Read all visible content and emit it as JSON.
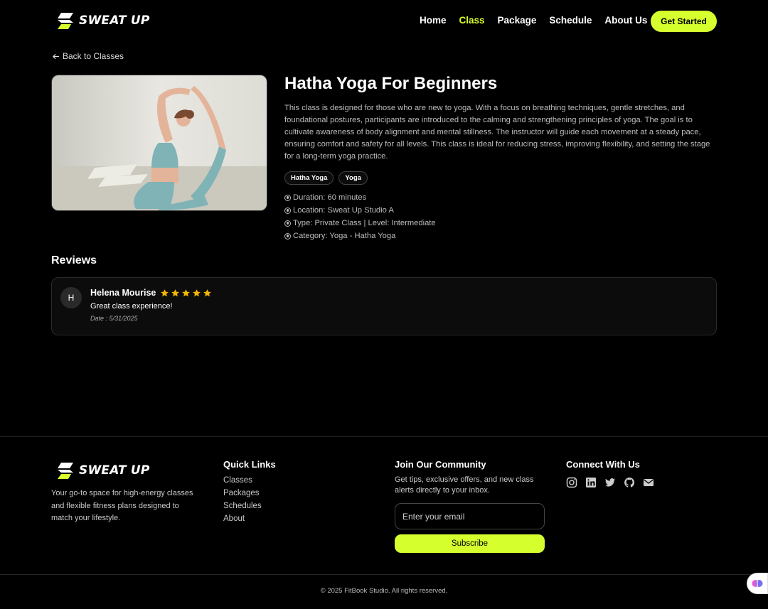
{
  "brand": {
    "name": "SWEAT UP",
    "accent": "#d6ff2e"
  },
  "nav": {
    "items": [
      {
        "label": "Home",
        "active": false
      },
      {
        "label": "Class",
        "active": true
      },
      {
        "label": "Package",
        "active": false
      },
      {
        "label": "Schedule",
        "active": false
      },
      {
        "label": "About Us",
        "active": false
      }
    ],
    "cta_label": "Get Started"
  },
  "back_link": {
    "label": "Back to Classes",
    "icon": "arrow-left-icon"
  },
  "class": {
    "title": "Hatha Yoga For Beginners",
    "description": "This class is designed for those who are new to yoga. With a focus on breathing techniques, gentle stretches, and foundational postures, participants are introduced to the calming and strengthening principles of yoga. The goal is to cultivate awareness of body alignment and mental stillness. The instructor will guide each movement at a steady pace, ensuring comfort and safety for all levels. This class is ideal for reducing stress, improving flexibility, and setting the stage for a long-term yoga practice.",
    "tags": [
      "Hatha Yoga",
      "Yoga"
    ],
    "info": [
      "Duration: 60 minutes",
      "Location: Sweat Up Studio A",
      "Type: Private Class | Level: Intermediate",
      "Category: Yoga - Hatha Yoga"
    ]
  },
  "reviews": {
    "title": "Reviews",
    "items": [
      {
        "avatar": "H",
        "name": "Helena Mourise",
        "rating": 5,
        "text": "Great class experience!",
        "date": "Date : 5/31/2025"
      }
    ]
  },
  "footer": {
    "about": "Your go-to space for high-energy classes and flexible fitness plans designed to match your lifestyle.",
    "quick_links": {
      "title": "Quick Links",
      "items": [
        "Classes",
        "Packages",
        "Schedules",
        "About"
      ]
    },
    "community": {
      "title": "Join Our Community",
      "text": "Get tips, exclusive offers, and new class alerts directly to your inbox.",
      "email_placeholder": "Enter your email",
      "subscribe_label": "Subscribe"
    },
    "connect": {
      "title": "Connect With Us",
      "icons": [
        "instagram-icon",
        "linkedin-icon",
        "twitter-icon",
        "github-icon",
        "mail-icon"
      ]
    },
    "copyright": "© 2025 FitBook Studio. All rights reserved."
  }
}
